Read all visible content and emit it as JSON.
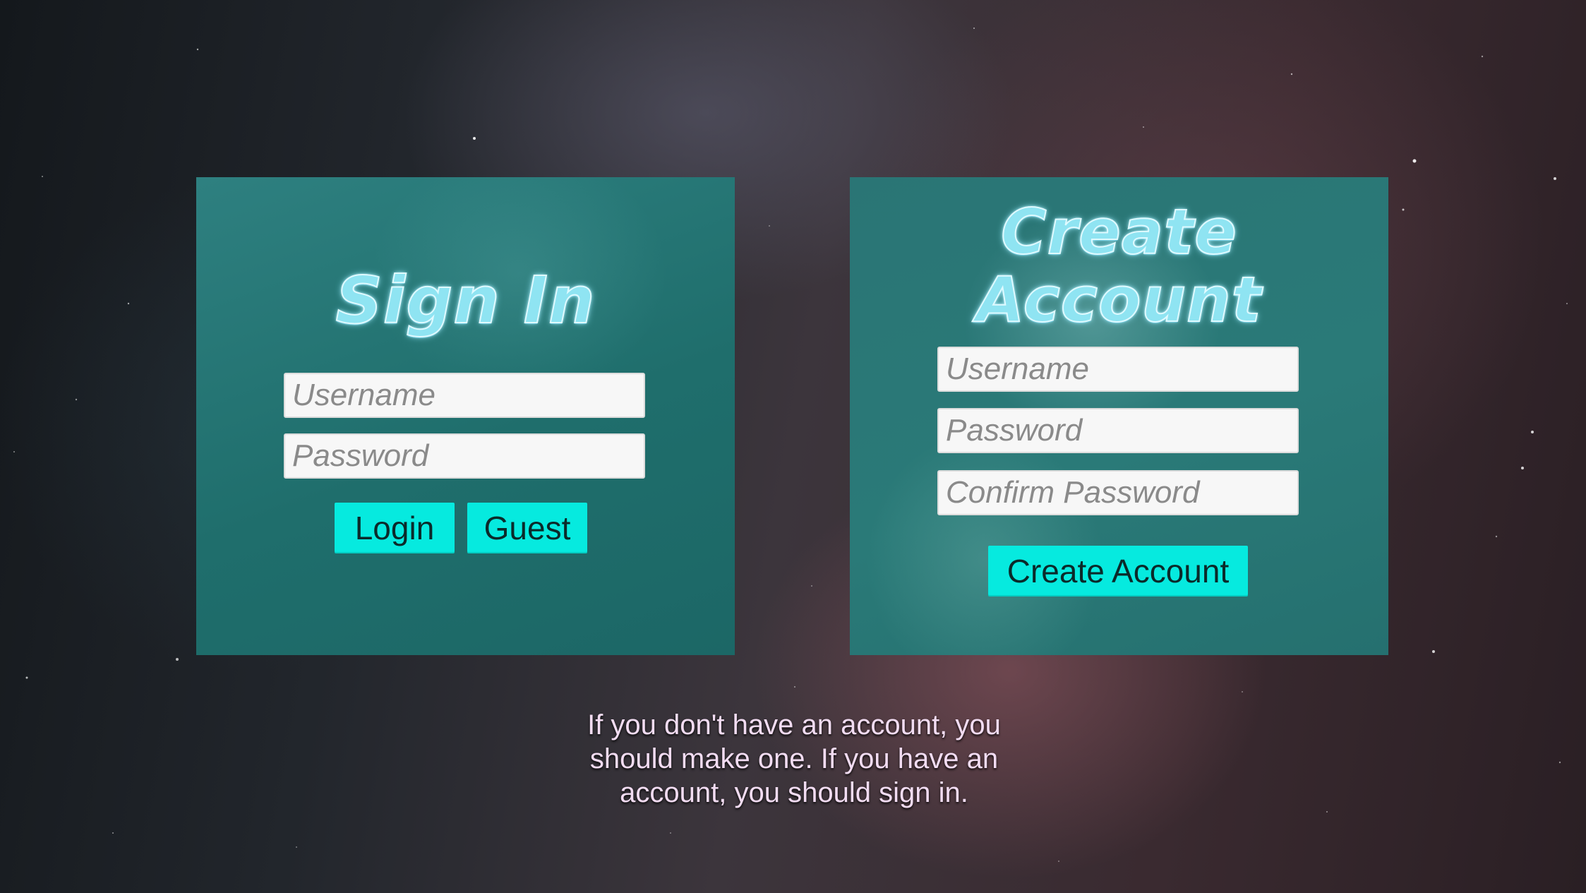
{
  "signin": {
    "title": "Sign In",
    "username_placeholder": "Username",
    "password_placeholder": "Password",
    "login_label": "Login",
    "guest_label": "Guest"
  },
  "create": {
    "title_line1": "Create",
    "title_line2": "Account",
    "username_placeholder": "Username",
    "password_placeholder": "Password",
    "confirm_placeholder": "Confirm Password",
    "create_label": "Create Account"
  },
  "hint": "If you don't have an account, you should make one. If you have an account, you should sign in.",
  "colors": {
    "panel": "#1f6e6c",
    "button": "#06eadf",
    "title": "#8fe4f2",
    "hint_text": "#f2dcf2"
  }
}
